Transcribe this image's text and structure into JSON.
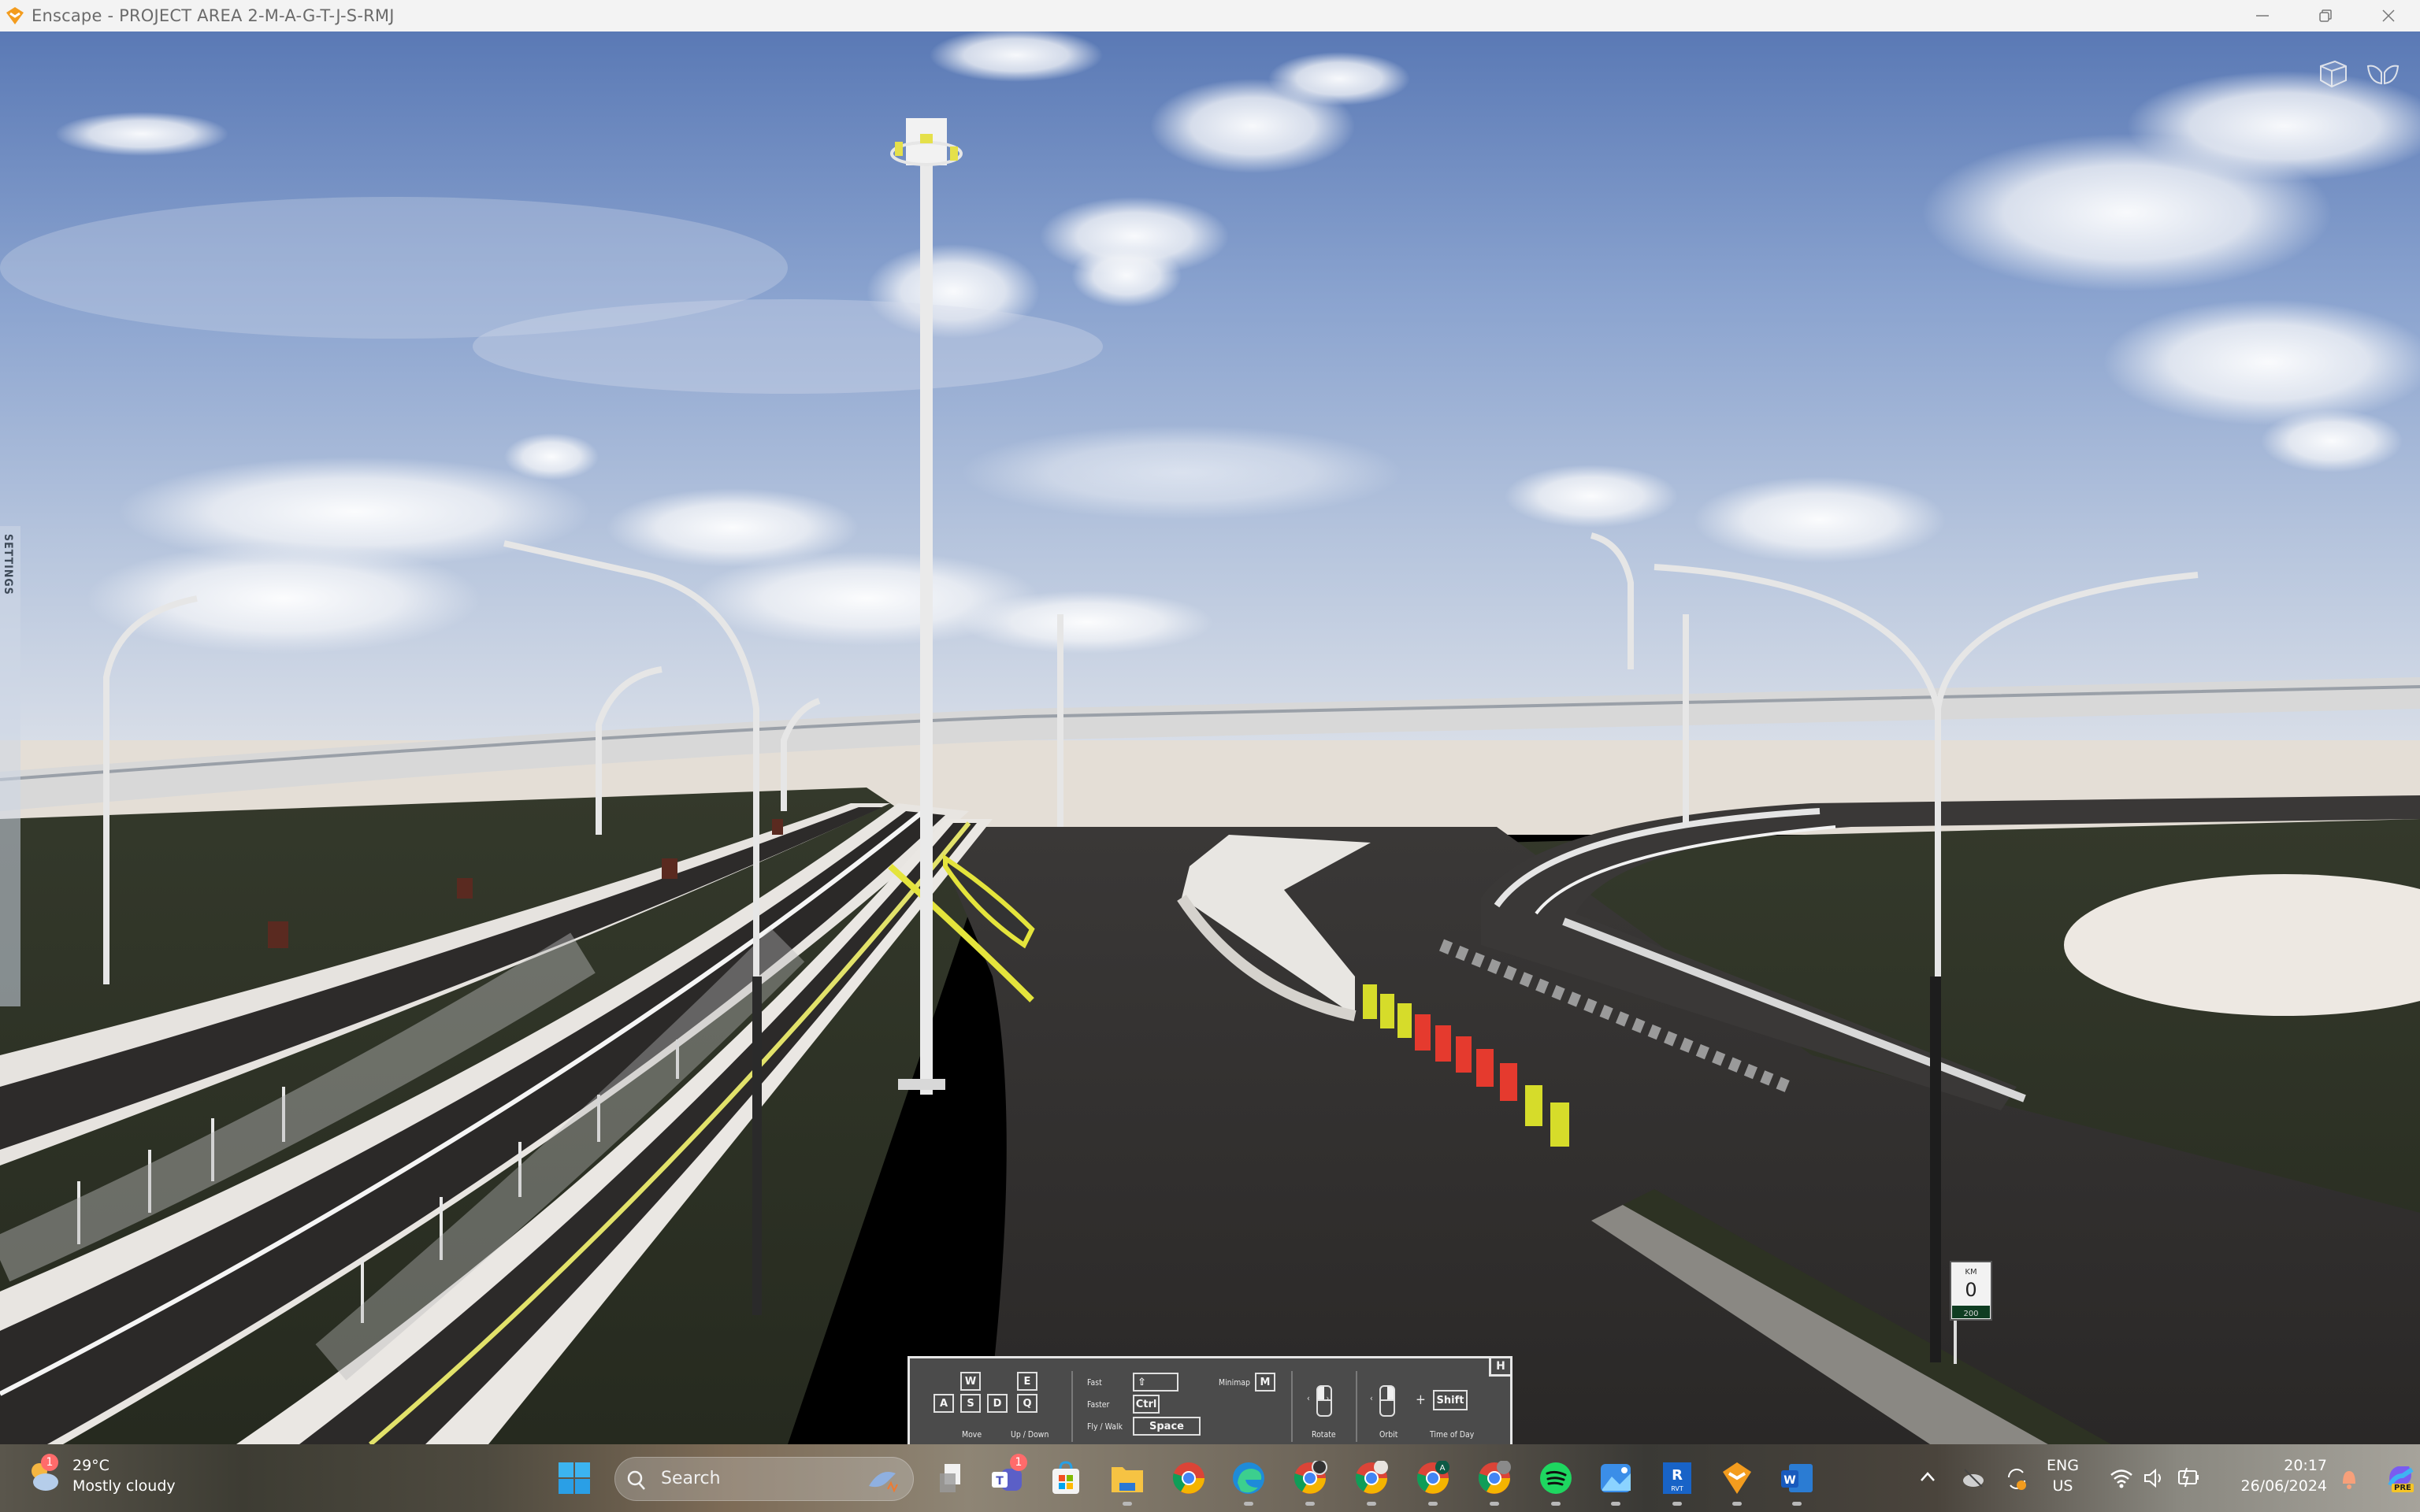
{
  "window": {
    "title": "Enscape - PROJECT AREA 2-M-A-G-T-J-S-RMJ",
    "app_icon": "enscape-logo-icon",
    "controls": [
      "minimize-icon",
      "restore-icon",
      "close-icon"
    ],
    "accent_color": "#f39c1e"
  },
  "viewport": {
    "settings_tab_label": "SETTINGS",
    "top_right_icons": [
      "view-cube-icon",
      "fly-mode-wings-icon"
    ],
    "scene_description": "3D rendered highway interchange with flyover ramps, high-mast lighting pole, street lights, red and yellow water-filled barriers, grass medians",
    "km_marker": {
      "header": "KM",
      "value": "0",
      "sub": "200"
    }
  },
  "controls_overlay": {
    "hide_key": "H",
    "move": {
      "keys": [
        "W",
        "A",
        "S",
        "D"
      ],
      "label": "Move"
    },
    "updown": {
      "keys": [
        "E",
        "Q"
      ],
      "label": "Up / Down"
    },
    "fast": {
      "label": "Fast",
      "key": "⇧"
    },
    "faster": {
      "label": "Faster",
      "key": "Ctrl"
    },
    "flywalk": {
      "label": "Fly / Walk",
      "key": "Space"
    },
    "minimap": {
      "label": "Minimap",
      "key": "M"
    },
    "rotate": {
      "label": "Rotate"
    },
    "orbit": {
      "label": "Orbit",
      "plus": "+"
    },
    "timeofday": {
      "label": "Time of Day",
      "key": "Shift"
    }
  },
  "taskbar": {
    "weather": {
      "temperature": "29°C",
      "condition": "Mostly cloudy",
      "badge": "1"
    },
    "search_placeholder": "Search",
    "apps": [
      {
        "name": "task-view",
        "icon": "task-view-icon"
      },
      {
        "name": "teams",
        "icon": "teams-icon",
        "badge": "1"
      },
      {
        "name": "microsoft-store",
        "icon": "store-icon"
      },
      {
        "name": "file-explorer",
        "icon": "folder-icon",
        "running": true
      },
      {
        "name": "chrome",
        "icon": "chrome-icon"
      },
      {
        "name": "edge",
        "icon": "edge-icon",
        "running": true
      },
      {
        "name": "chrome-profile-1",
        "icon": "chrome-icon",
        "running": true
      },
      {
        "name": "chrome-profile-2",
        "icon": "chrome-icon",
        "running": true
      },
      {
        "name": "chrome-profile-A",
        "icon": "chrome-icon",
        "profile_letter": "A",
        "running": true
      },
      {
        "name": "chrome-profile-3",
        "icon": "chrome-icon",
        "running": true
      },
      {
        "name": "spotify",
        "icon": "spotify-icon",
        "running": true
      },
      {
        "name": "photos",
        "icon": "photos-icon",
        "running": true
      },
      {
        "name": "revit",
        "icon": "revit-icon",
        "label": "RVT",
        "letter": "R",
        "running": true
      },
      {
        "name": "enscape",
        "icon": "enscape-icon",
        "running": true
      },
      {
        "name": "word",
        "icon": "word-icon",
        "letter": "W",
        "running": true
      }
    ],
    "tray": {
      "language_line1": "ENG",
      "language_line2": "US",
      "time": "20:17",
      "date": "26/06/2024",
      "copilot_badge": "PRE"
    }
  }
}
